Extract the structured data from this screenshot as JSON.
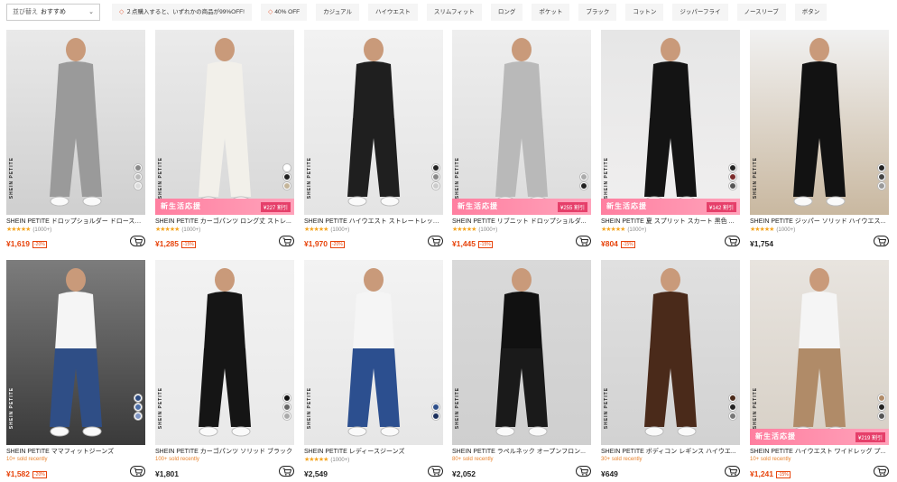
{
  "sort": {
    "label": "並び替え",
    "value": "おすすめ"
  },
  "chips": [
    {
      "label": "２点購入すると、いずれかの商品が99%OFF!",
      "tag": true
    },
    {
      "label": "40% OFF",
      "tag": true
    },
    {
      "label": "カジュアル"
    },
    {
      "label": "ハイウエスト"
    },
    {
      "label": "スリムフィット"
    },
    {
      "label": "ロング"
    },
    {
      "label": "ポケット"
    },
    {
      "label": "ブラック"
    },
    {
      "label": "コットン"
    },
    {
      "label": "ジッパーフライ"
    },
    {
      "label": "ノースリーブ"
    },
    {
      "label": "ボタン"
    }
  ],
  "brand_vertical": "SHEIN PETITE",
  "banner_text": "新生活応援",
  "products": [
    {
      "title": "SHEIN PETITE ドロップショルダー ドロースト...",
      "stars": "★★★★★",
      "reviews": "(1000+)",
      "price": "¥1,619",
      "discount": "-20%"
    },
    {
      "title": "SHEIN PETITE カーゴパンツ ロング丈 ストレ...",
      "stars": "★★★★★",
      "reviews": "(1000+)",
      "price": "¥1,285",
      "discount": "-15%",
      "banner_price": "¥227 割引"
    },
    {
      "title": "SHEIN PETITE ハイウエスト ストレートレッグ...",
      "stars": "★★★★★",
      "reviews": "(1000+)",
      "price": "¥1,970",
      "discount": "-20%"
    },
    {
      "title": "SHEIN PETITE リブニット ドロップショルダ...",
      "stars": "★★★★★",
      "reviews": "(1000+)",
      "price": "¥1,445",
      "discount": "-15%",
      "banner_price": "¥255 割引"
    },
    {
      "title": "SHEIN PETITE 夏 スプリット スカート 黒色 ...",
      "stars": "★★★★★",
      "reviews": "(1000+)",
      "price": "¥804",
      "discount": "-15%",
      "banner_price": "¥142 割引"
    },
    {
      "title": "SHEIN PETITE ジッパー ソリッド ハイウエス...",
      "stars": "★★★★★",
      "reviews": "(1000+)",
      "price": "¥1,754",
      "discount": ""
    },
    {
      "title": "SHEIN PETITE ママフィットジーンズ",
      "sold": "10+ sold recently",
      "price": "¥1,582",
      "discount": "-20%"
    },
    {
      "title": "SHEIN PETITE カーゴパンツ ソリッド ブラック",
      "sold": "100+ sold recently",
      "price": "¥1,801",
      "discount": ""
    },
    {
      "title": "SHEIN PETITE レディースジーンズ",
      "stars": "★★★★★",
      "reviews": "(1000+)",
      "price": "¥2,549",
      "discount": ""
    },
    {
      "title": "SHEIN PETITE ラペルネック オープンフロン...",
      "sold": "80+ sold recently",
      "price": "¥2,052",
      "discount": ""
    },
    {
      "title": "SHEIN PETITE ボディコン レギンス ハイウエ...",
      "sold": "30+ sold recently",
      "price": "¥649",
      "discount": ""
    },
    {
      "title": "SHEIN PETITE ハイウエスト ワイドレッグ プ...",
      "sold": "10+ sold recently",
      "price": "¥1,241",
      "discount": "-15%",
      "banner_price": "¥219 割引"
    }
  ]
}
